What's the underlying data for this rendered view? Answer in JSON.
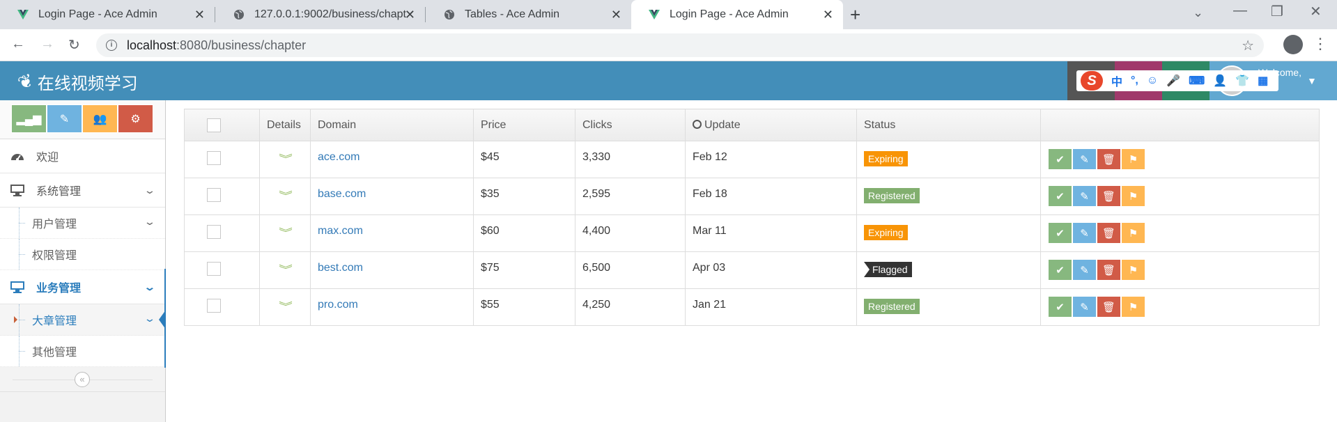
{
  "browser": {
    "tabs": [
      {
        "title": "Login Page - Ace Admin",
        "icon": "vue-icon"
      },
      {
        "title": "127.0.0.1:9002/business/chapt",
        "icon": "globe-icon"
      },
      {
        "title": "Tables - Ace Admin",
        "icon": "globe-icon"
      },
      {
        "title": "Login Page - Ace Admin",
        "icon": "vue-icon",
        "active": true
      }
    ],
    "url_host": "localhost",
    "url_path": ":8080/business/chapter"
  },
  "header": {
    "brand": "在线视频学习",
    "welcome_line1": "Welcome,",
    "welcome_line2": "nd",
    "ime_items": [
      "中",
      "°,",
      "☺",
      "🎤",
      "⌨",
      "👤",
      "👕",
      "▦"
    ]
  },
  "sidebar": {
    "welcome": "欢迎",
    "system": "系统管理",
    "user_mgmt": "用户管理",
    "perm_mgmt": "权限管理",
    "business": "业务管理",
    "chapter_mgmt": "大章管理",
    "other_mgmt": "其他管理"
  },
  "table": {
    "headers": {
      "details": "Details",
      "domain": "Domain",
      "price": "Price",
      "clicks": "Clicks",
      "update": "Update",
      "status": "Status"
    },
    "rows": [
      {
        "domain": "ace.com",
        "price": "$45",
        "clicks": "3,330",
        "update": "Feb 12",
        "status": "Expiring"
      },
      {
        "domain": "base.com",
        "price": "$35",
        "clicks": "2,595",
        "update": "Feb 18",
        "status": "Registered"
      },
      {
        "domain": "max.com",
        "price": "$60",
        "clicks": "4,400",
        "update": "Mar 11",
        "status": "Expiring"
      },
      {
        "domain": "best.com",
        "price": "$75",
        "clicks": "6,500",
        "update": "Apr 03",
        "status": "Flagged"
      },
      {
        "domain": "pro.com",
        "price": "$55",
        "clicks": "4,250",
        "update": "Jan 21",
        "status": "Registered"
      }
    ]
  },
  "colors": {
    "navbar": "#438eb9",
    "accent": "#2b7dbc",
    "expiring": "#f89406",
    "registered": "#82af6f",
    "flagged": "#333333"
  }
}
